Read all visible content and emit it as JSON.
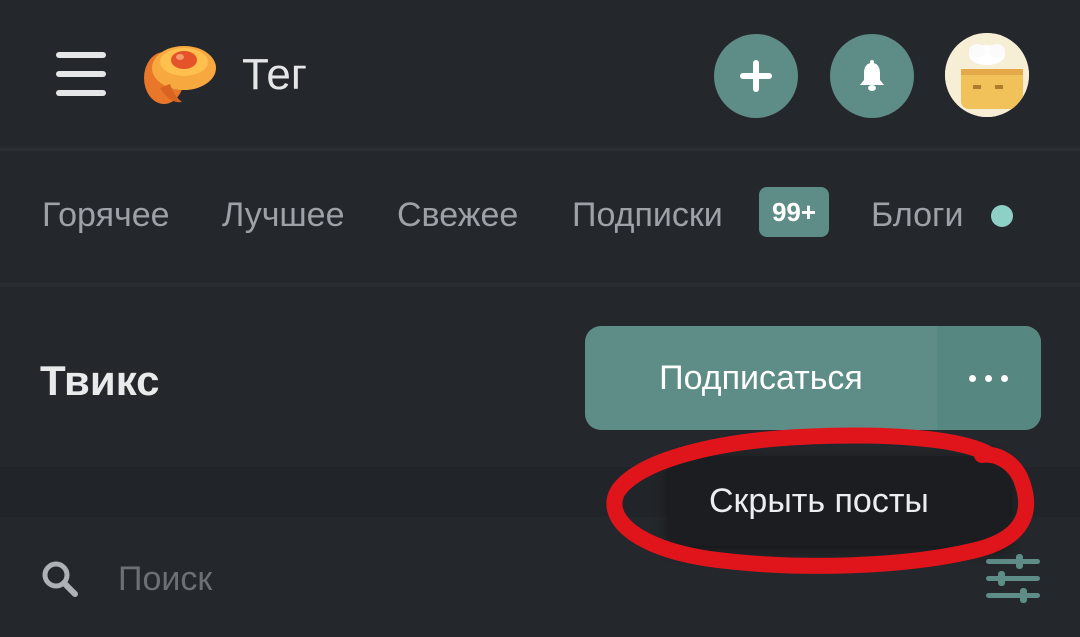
{
  "header": {
    "title": "Тег",
    "menu_icon": "hamburger-menu-icon",
    "logo_icon": "mushroom-logo-icon",
    "add_icon": "plus-icon",
    "notifications_icon": "bell-icon",
    "avatar_icon": "user-avatar-icon"
  },
  "tabs": {
    "items": [
      {
        "label": "Горячее"
      },
      {
        "label": "Лучшее"
      },
      {
        "label": "Свежее"
      },
      {
        "label": "Подписки"
      },
      {
        "label": "Блоги"
      }
    ],
    "subscriptions_badge": "99+"
  },
  "tag": {
    "name": "Твикс",
    "subscribe_label": "Подписаться",
    "more_icon": "more-dots-icon"
  },
  "dropdown": {
    "item_label": "Скрыть посты"
  },
  "search": {
    "placeholder": "Поиск",
    "search_icon": "search-icon",
    "filter_icon": "filter-sliders-icon"
  },
  "colors": {
    "background": "#24272b",
    "accent": "#5e8c86",
    "text_primary": "#e4e6e8",
    "text_muted": "#9da2a8",
    "annotation_red": "#e0151b"
  }
}
